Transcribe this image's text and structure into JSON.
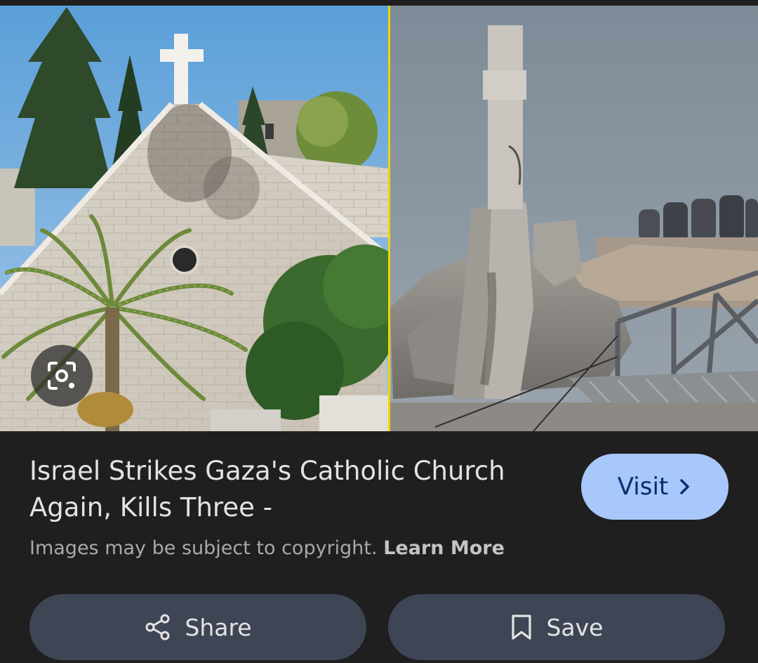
{
  "image": {
    "description_icon": "lens-icon"
  },
  "result": {
    "title": "Israel Strikes Gaza's Catholic Church Again, Kills Three -",
    "visit_label": "Visit",
    "visit_icon": "chevron-right-icon",
    "copyright_text": "Images may be subject to copyright.",
    "learn_more_label": "Learn More"
  },
  "actions": {
    "share_label": "Share",
    "share_icon": "share-icon",
    "save_label": "Save",
    "save_icon": "bookmark-icon"
  },
  "colors": {
    "background": "#1f1f1f",
    "visit_button": "#a8c7fa",
    "action_button": "#3e4555",
    "divider": "#f2d400"
  }
}
